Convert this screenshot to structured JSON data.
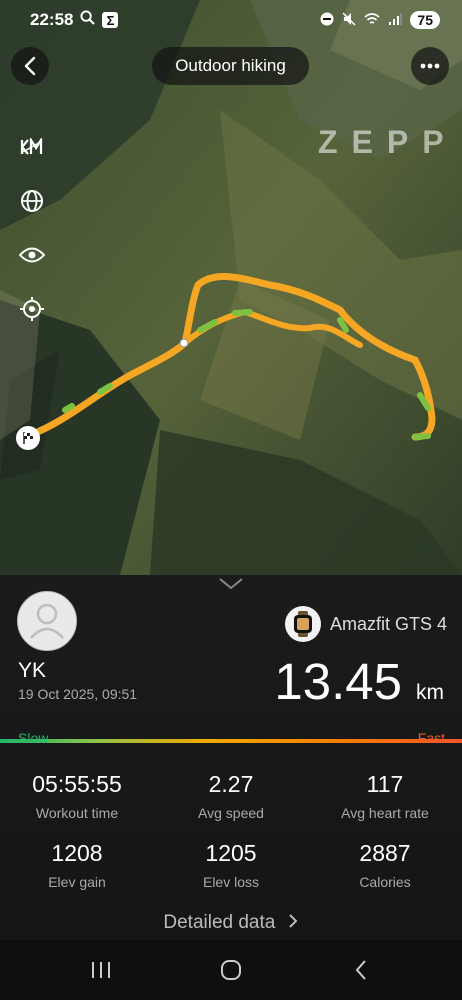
{
  "status_bar": {
    "time": "22:58",
    "battery": "75"
  },
  "header": {
    "title": "Outdoor hiking"
  },
  "map": {
    "brand": "ZEPP"
  },
  "workout": {
    "user_name": "YK",
    "datetime": "19 Oct 2025, 09:51",
    "device": "Amazfit GTS 4",
    "distance": "13.45",
    "distance_unit": "km",
    "speed_scale": {
      "slow": "Slow",
      "fast": "Fast"
    }
  },
  "stats": [
    {
      "value": "05:55:55",
      "label": "Workout time"
    },
    {
      "value": "2.27",
      "label": "Avg speed"
    },
    {
      "value": "117",
      "label": "Avg heart rate"
    },
    {
      "value": "1208",
      "label": "Elev gain"
    },
    {
      "value": "1205",
      "label": "Elev loss"
    },
    {
      "value": "2887",
      "label": "Calories"
    }
  ],
  "detail_link": "Detailed data"
}
